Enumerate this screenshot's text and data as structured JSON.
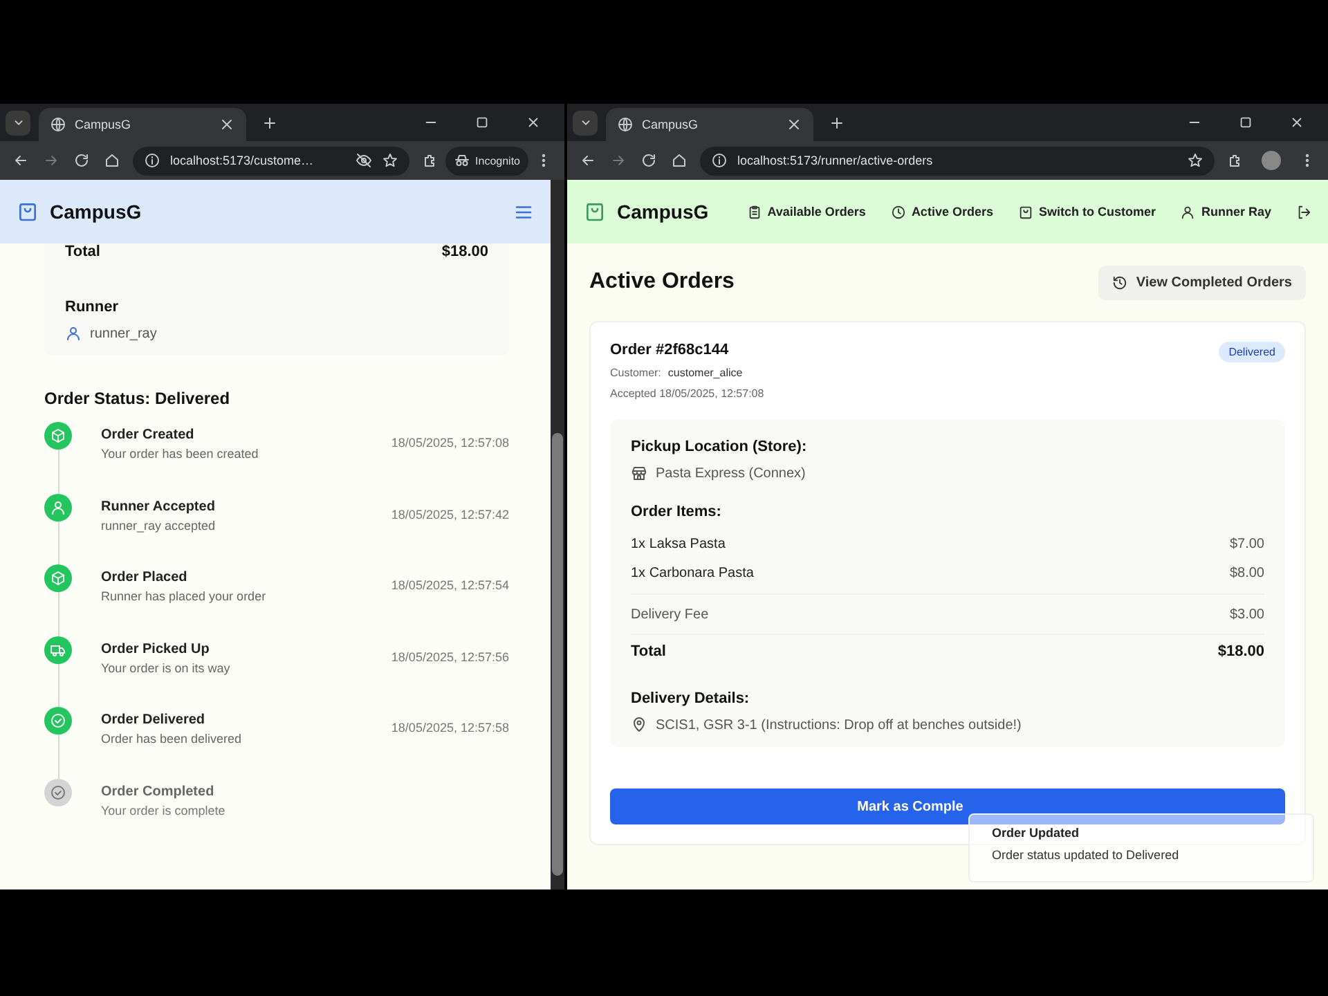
{
  "left_window": {
    "tab": {
      "title": "CampusG"
    },
    "address": "localhost:5173/custome…",
    "profile": "Incognito",
    "app": {
      "brand": "CampusG",
      "summary": {
        "total_label": "Total",
        "total_value": "$18.00",
        "runner_label": "Runner",
        "runner_name": "runner_ray"
      },
      "status_title": "Order Status: Delivered",
      "steps": [
        {
          "kind": "package",
          "title": "Order Created",
          "description": "Your order has been created",
          "time": "18/05/2025, 12:57:08",
          "done": true
        },
        {
          "kind": "user",
          "title": "Runner Accepted",
          "description": "runner_ray accepted",
          "time": "18/05/2025, 12:57:42",
          "done": true
        },
        {
          "kind": "package",
          "title": "Order Placed",
          "description": "Runner has placed your order",
          "time": "18/05/2025, 12:57:54",
          "done": true
        },
        {
          "kind": "truck",
          "title": "Order Picked Up",
          "description": "Your order is on its way",
          "time": "18/05/2025, 12:57:56",
          "done": true
        },
        {
          "kind": "check",
          "title": "Order Delivered",
          "description": "Order has been delivered",
          "time": "18/05/2025, 12:57:58",
          "done": true
        },
        {
          "kind": "check",
          "title": "Order Completed",
          "description": "Your order is complete",
          "done": false
        }
      ]
    }
  },
  "right_window": {
    "tab": {
      "title": "CampusG"
    },
    "address": "localhost:5173/runner/active-orders",
    "app": {
      "brand": "CampusG",
      "nav": [
        {
          "kind": "clipboard",
          "label": "Available Orders"
        },
        {
          "kind": "clock",
          "label": "Active Orders"
        },
        {
          "kind": "bag",
          "label": "Switch to Customer"
        },
        {
          "kind": "user",
          "label": "Runner Ray"
        },
        {
          "kind": "logout"
        }
      ],
      "page_title": "Active Orders",
      "history_button": "View Completed Orders",
      "order": {
        "number": "Order #2f68c144",
        "status": "Delivered",
        "customer_label": "Customer:",
        "customer": "customer_alice",
        "accepted": "Accepted 18/05/2025, 12:57:08",
        "pickup_label": "Pickup Location (Store):",
        "store": "Pasta Express (Connex)",
        "items_label": "Order Items:",
        "items": [
          {
            "name": "1x Laksa Pasta",
            "price": "$7.00"
          },
          {
            "name": "1x Carbonara Pasta",
            "price": "$8.00"
          }
        ],
        "fee_label": "Delivery Fee",
        "fee": "$3.00",
        "total_label": "Total",
        "total": "$18.00",
        "delivery_label": "Delivery Details:",
        "address": "SCIS1, GSR 3-1 (Instructions: Drop off at benches outside!)",
        "action": "Mark as Comple"
      },
      "toast": {
        "title": "Order Updated",
        "message": "Order status updated to Delivered"
      }
    }
  }
}
